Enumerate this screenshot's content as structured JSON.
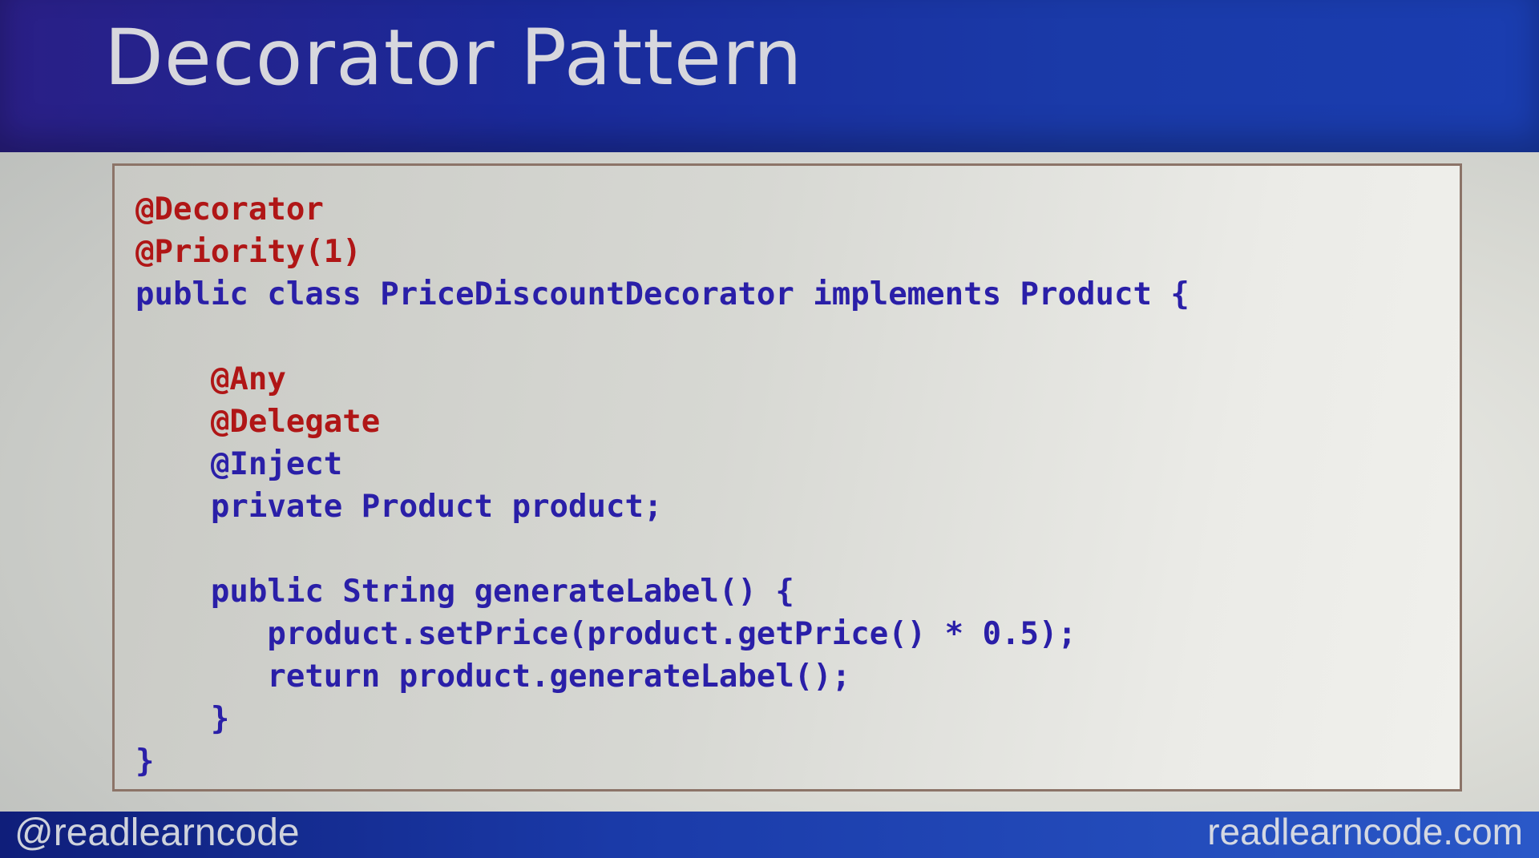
{
  "slide": {
    "title": "Decorator Pattern",
    "footer": {
      "handle": "@readlearncode",
      "site": "readlearncode.com"
    },
    "colors": {
      "header": "#1a2a9a",
      "annotation": "#b01616",
      "code": "#2a1fa8",
      "box_border": "#8c7468"
    },
    "code_lines": [
      {
        "text": "@Decorator",
        "type": "annotation"
      },
      {
        "text": "@Priority(1)",
        "type": "annotation"
      },
      {
        "text": "public class PriceDiscountDecorator implements Product {",
        "type": "code"
      },
      {
        "text": "",
        "type": "code"
      },
      {
        "text": "    @Any",
        "type": "annotation"
      },
      {
        "text": "    @Delegate",
        "type": "annotation"
      },
      {
        "text": "    @Inject",
        "type": "code"
      },
      {
        "text": "    private Product product;",
        "type": "code"
      },
      {
        "text": "",
        "type": "code"
      },
      {
        "text": "    public String generateLabel() {",
        "type": "code"
      },
      {
        "text": "       product.setPrice(product.getPrice() * 0.5);",
        "type": "code"
      },
      {
        "text": "       return product.generateLabel();",
        "type": "code"
      },
      {
        "text": "    }",
        "type": "code"
      },
      {
        "text": "}",
        "type": "code"
      }
    ]
  }
}
